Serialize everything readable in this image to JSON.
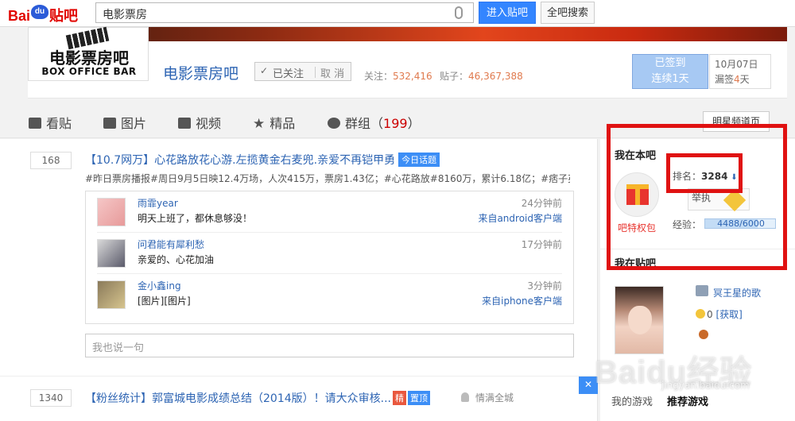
{
  "topbar": {
    "logo_baidu": "Bai",
    "logo_du": "du",
    "logo_tieba": "贴吧",
    "search_value": "电影票房",
    "enter_button": "进入贴吧",
    "all_search_button": "全吧搜索"
  },
  "forum": {
    "logo_cn": "电影票房吧",
    "logo_en": "BOX OFFICE BAR",
    "title": "电影票房吧",
    "follow_label": "已关注",
    "unfollow_label": "取 消",
    "followers_label": "关注：",
    "followers": "532,416",
    "posts_label": "贴子：",
    "posts": "46,367,388"
  },
  "signin": {
    "line1": "已签到",
    "line2": "连续1天",
    "date": "10月07日",
    "missed_prefix": "漏签",
    "missed_num": "4",
    "missed_suffix": "天"
  },
  "tabs": [
    {
      "label": "看贴"
    },
    {
      "label": "图片"
    },
    {
      "label": "视频"
    },
    {
      "label": "精品"
    },
    {
      "label": "群组",
      "count": "199"
    }
  ],
  "tabs_extra": {
    "open_paren": "（",
    "close_paren": "）"
  },
  "star_channel_button": "明星频道页",
  "thread1": {
    "replies": "168",
    "title": "【10.7网万】心花路放花心游.左揽黄金右麦兜.亲爱不再铠甲勇",
    "badge": "今日话题",
    "summary": "#昨日票房播报#周日9月5日映12.4万场，人次415万，票房1.43亿；#心花路放#8160万，累计6.18亿；#痞子英雄..."
  },
  "replies": [
    {
      "user": "雨霏year",
      "text": "明天上班了，都休息够没！",
      "time": "24分钟前",
      "source": "来自android客户端"
    },
    {
      "user": "问君能有犀利愁",
      "text": "亲爱的、心花加油",
      "time": "17分钟前",
      "source": ""
    },
    {
      "user": "金小鑫ing",
      "text": "[图片][图片]",
      "time": "3分钟前",
      "source": "来自iphone客户端"
    }
  ],
  "reply_placeholder": "我也说一句",
  "thread2": {
    "replies": "1340",
    "title": "【粉丝统计】郭富城电影成绩总结（2014版）！请大众审核...",
    "badge_jing": "精",
    "badge_top": "置顶",
    "author": "情满全城",
    "close": "✕"
  },
  "sidebar": {
    "my_bar_title": "我在本吧",
    "gift_label": "吧特权包",
    "rank_label": "排名：",
    "rank_value": "3284",
    "rank_arrow": "⬇",
    "level_label": "举执",
    "exp_label": "经验：",
    "exp_current": "4488",
    "exp_total": "6000",
    "exp_fraction": 0.748,
    "my_tieba_title": "我在贴吧",
    "profile_name": "冥王星的歌",
    "coin_value": "0",
    "coin_get": "[获取]",
    "tab_games": "我的游戏",
    "tab_recommend": "推荐游戏"
  },
  "watermark": {
    "main": "Baidu经验",
    "sub": "jingyan.baidu.com"
  }
}
